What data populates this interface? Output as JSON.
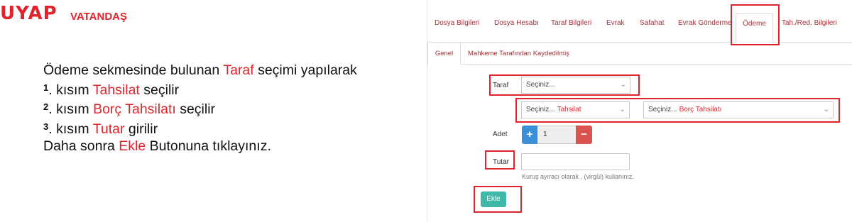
{
  "logo": {
    "main": "UYAP",
    "sub": "VATANDAŞ"
  },
  "instructions": {
    "line1": {
      "pre": "Ödeme sekmesinde bulunan ",
      "hl": "Taraf",
      "post": " seçimi yapılarak"
    },
    "line2": {
      "num": "1",
      "pre": ". kısım ",
      "hl": "Tahsilat",
      "post": " seçilir"
    },
    "line3": {
      "num": "2",
      "pre": ". kısım ",
      "hl": "Borç Tahsilatı",
      "post": " seçilir"
    },
    "line4": {
      "num": "3",
      "pre": ". kısım ",
      "hl": "Tutar",
      "post": " girilir"
    },
    "line5": {
      "pre": "Daha sonra ",
      "hl": "Ekle",
      "post": " Butonuna tıklayınız."
    }
  },
  "tabs": [
    "Dosya Bilgileri",
    "Dosya Hesabı",
    "Taraf Bilgileri",
    "Evrak",
    "Safahat",
    "Evrak Gönderme",
    "Ödeme",
    "Tah./Red. Bilgileri"
  ],
  "active_tab": "Ödeme",
  "subtabs": [
    "Genel",
    "Mahkeme Tarafından Kaydedilmiş"
  ],
  "form": {
    "taraf_label": "Taraf",
    "taraf_placeholder": "Seçiniz...",
    "select2_placeholder": "Seçiniz...",
    "select2_note": "Tahsilat",
    "select3_placeholder": "Seçiniz...",
    "select3_note": "Borç Tahsilatı",
    "adet_label": "Adet",
    "adet_value": "1",
    "plus": "+",
    "minus": "−",
    "tutar_label": "Tutar",
    "tutar_value": "",
    "hint": "Kuruş ayıracı olarak , (virgül) kullanınız.",
    "ekle_label": "Ekle"
  },
  "colors": {
    "accent": "#e1232b",
    "tab_text": "#a4323b",
    "plus": "#3b8fd9",
    "minus": "#d9534f",
    "ekle": "#3fb8a8"
  }
}
